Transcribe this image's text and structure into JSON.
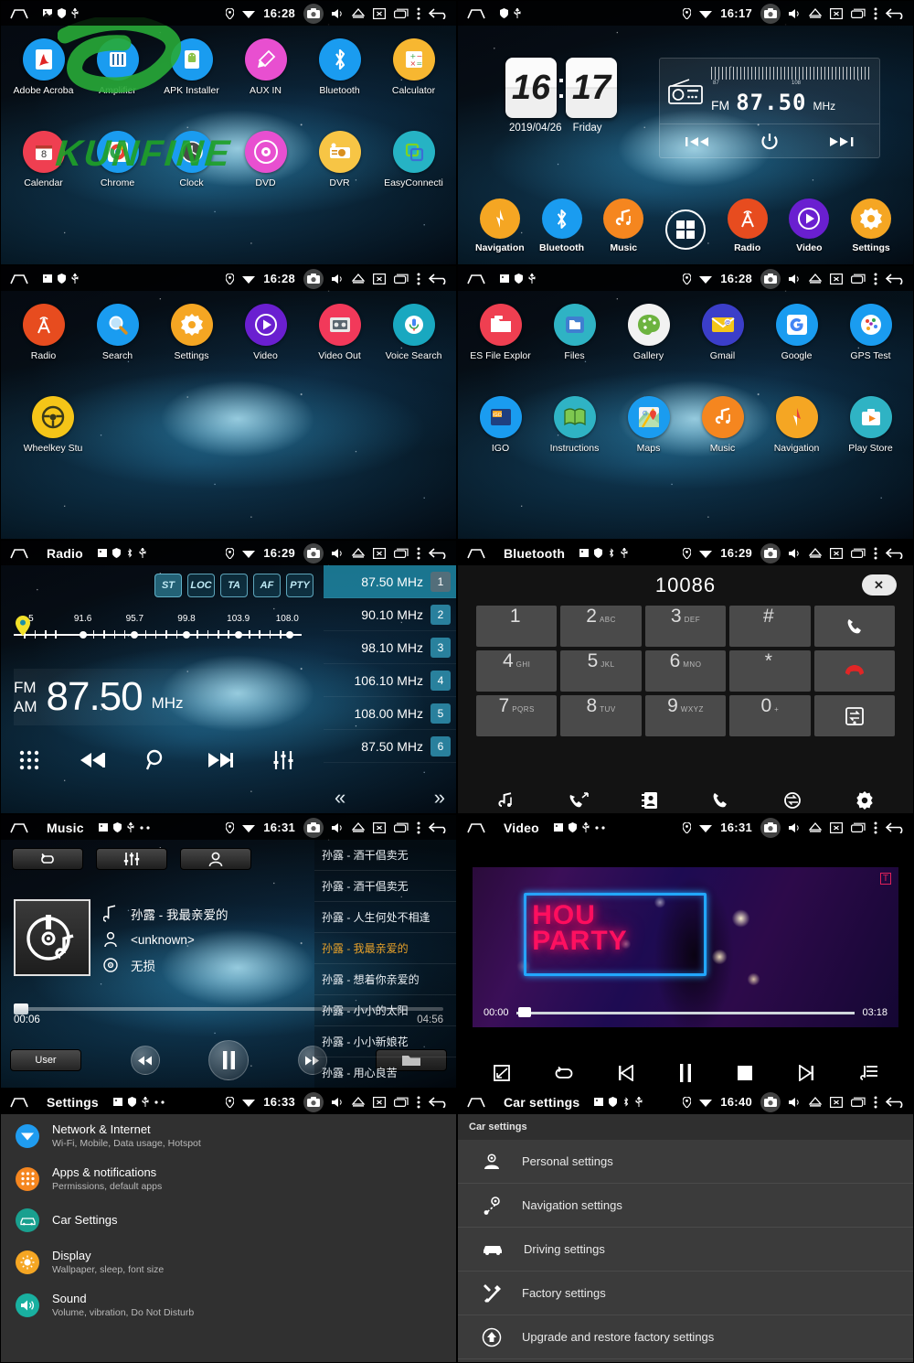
{
  "statusbar": {
    "icons_left": [
      "home-icon",
      "image-icon",
      "shield-icon",
      "usb-icon"
    ],
    "icons_right": [
      "location-icon",
      "wifi-icon",
      "camera-icon",
      "volume-icon",
      "eject-icon",
      "screen-off-icon",
      "recents-icon",
      "overflow-icon",
      "back-icon"
    ],
    "times": {
      "p1": "16:28",
      "p2": "16:17",
      "p3": "16:28",
      "p4": "16:28",
      "p5": "16:29",
      "p6": "16:29",
      "p7": "16:31",
      "p8": "16:31",
      "p9": "16:33",
      "p10": "16:40"
    },
    "titles": {
      "radio": "Radio",
      "bluetooth": "Bluetooth",
      "music": "Music",
      "video": "Video",
      "settings": "Settings",
      "car_settings": "Car settings"
    }
  },
  "watermark": "KUNFINE",
  "app_drawer_page1": {
    "row1": [
      {
        "label": "Adobe Acroba",
        "icon": "adobe-acrobat-icon",
        "color": "#1a9cf0"
      },
      {
        "label": "Amplifier",
        "icon": "amplifier-icon",
        "color": "#1a9cf0"
      },
      {
        "label": "APK Installer",
        "icon": "apk-installer-icon",
        "color": "#1a9cf0"
      },
      {
        "label": "AUX IN",
        "icon": "aux-in-icon",
        "color": "#e84fd0"
      },
      {
        "label": "Bluetooth",
        "icon": "bluetooth-icon",
        "color": "#1a9cf0"
      },
      {
        "label": "Calculator",
        "icon": "calculator-icon",
        "color": "#f7b731"
      }
    ],
    "row2": [
      {
        "label": "Calendar",
        "icon": "calendar-icon",
        "color": "#ef3f51",
        "badge": "8"
      },
      {
        "label": "Chrome",
        "icon": "chrome-icon",
        "color": "#1a9cf0"
      },
      {
        "label": "Clock",
        "icon": "clock-icon",
        "color": "#1a9cf0"
      },
      {
        "label": "DVD",
        "icon": "dvd-icon",
        "color": "#e84fd0"
      },
      {
        "label": "DVR",
        "icon": "dvr-icon",
        "color": "#f7c545"
      },
      {
        "label": "EasyConnecti",
        "icon": "easyconnection-icon",
        "color": "#26b3c4"
      }
    ]
  },
  "app_drawer_page2": {
    "row1": [
      {
        "label": "Radio",
        "icon": "radio-tower-icon",
        "color": "#e74c1f"
      },
      {
        "label": "Search",
        "icon": "search-icon",
        "color": "#1a9cf0"
      },
      {
        "label": "Settings",
        "icon": "gear-icon",
        "color": "#f5a623"
      },
      {
        "label": "Video",
        "icon": "video-play-icon",
        "color": "#6a1fd0"
      },
      {
        "label": "Video Out",
        "icon": "video-out-icon",
        "color": "#f2395a"
      },
      {
        "label": "Voice Search",
        "icon": "microphone-icon",
        "color": "#19a8c0"
      }
    ],
    "row2": [
      {
        "label": "Wheelkey Stu",
        "icon": "steering-wheel-icon",
        "color": "#f5c518"
      }
    ]
  },
  "app_drawer_page3": {
    "row1": [
      {
        "label": "ES File Explor",
        "icon": "es-file-explorer-icon",
        "color": "#ef3f51"
      },
      {
        "label": "Files",
        "icon": "files-icon",
        "color": "#2fb3c4"
      },
      {
        "label": "Gallery",
        "icon": "gallery-palette-icon",
        "color": "#f2f2f2"
      },
      {
        "label": "Gmail",
        "icon": "gmail-icon",
        "color": "#3b3ec9"
      },
      {
        "label": "Google",
        "icon": "google-icon",
        "color": "#1a9cf0"
      },
      {
        "label": "GPS Test",
        "icon": "gps-test-icon",
        "color": "#1a9cf0"
      }
    ],
    "row2": [
      {
        "label": "IGO",
        "icon": "igo-icon",
        "color": "#1a9cf0"
      },
      {
        "label": "Instructions",
        "icon": "instructions-book-icon",
        "color": "#2fb3c4"
      },
      {
        "label": "Maps",
        "icon": "maps-icon",
        "color": "#1a9cf0"
      },
      {
        "label": "Music",
        "icon": "music-note-icon",
        "color": "#f5861f"
      },
      {
        "label": "Navigation",
        "icon": "compass-icon",
        "color": "#f5a623"
      },
      {
        "label": "Play Store",
        "icon": "play-store-icon",
        "color": "#2fb3c4"
      }
    ]
  },
  "home": {
    "clock": {
      "hour": "16",
      "minute": "17",
      "date": "2019/04/26",
      "weekday": "Friday"
    },
    "radio_widget": {
      "band": "FM",
      "frequency": "87.50",
      "unit": "MHz",
      "scale_min": "87",
      "scale_max": "108",
      "prev_label": "prev-station-button",
      "power_label": "power-button",
      "next_label": "next-station-button"
    },
    "dock": [
      {
        "label": "Navigation",
        "icon": "compass-icon",
        "color": "#f5a623"
      },
      {
        "label": "Bluetooth",
        "icon": "bluetooth-icon",
        "color": "#1a9cf0"
      },
      {
        "label": "Music",
        "icon": "music-note-icon",
        "color": "#f5861f"
      },
      {
        "label": "",
        "icon": "all-apps-icon",
        "color": "transparent"
      },
      {
        "label": "Radio",
        "icon": "radio-tower-icon",
        "color": "#e74c1f"
      },
      {
        "label": "Video",
        "icon": "video-play-icon",
        "color": "#6a1fd0"
      },
      {
        "label": "Settings",
        "icon": "gear-icon",
        "color": "#f5a623"
      }
    ]
  },
  "radio": {
    "band_buttons": [
      {
        "label": "ST",
        "active": true
      },
      {
        "label": "LOC",
        "active": false
      },
      {
        "label": "TA",
        "active": false
      },
      {
        "label": "AF",
        "active": false
      },
      {
        "label": "PTY",
        "active": false
      }
    ],
    "scale_labels": [
      "5",
      "91.6",
      "95.7",
      "99.8",
      "103.9",
      "108.0"
    ],
    "band_fm": "FM",
    "band_am": "AM",
    "frequency": "87.50",
    "unit": "MHz",
    "presets": [
      {
        "freq": "87.50 MHz",
        "num": "1",
        "selected": true
      },
      {
        "freq": "90.10 MHz",
        "num": "2",
        "selected": false
      },
      {
        "freq": "98.10 MHz",
        "num": "3",
        "selected": false
      },
      {
        "freq": "106.10 MHz",
        "num": "4",
        "selected": false
      },
      {
        "freq": "108.00 MHz",
        "num": "5",
        "selected": false
      },
      {
        "freq": "87.50 MHz",
        "num": "6",
        "selected": false
      }
    ],
    "controls": [
      "apps-grid-icon",
      "prev-track-icon",
      "scan-search-icon",
      "next-track-icon",
      "equalizer-icon"
    ],
    "page_prev": "«",
    "page_next": "»"
  },
  "bluetooth": {
    "number": "10086",
    "delete_label": "✕",
    "keys": [
      {
        "d": "1",
        "s": ""
      },
      {
        "d": "2",
        "s": "ABC"
      },
      {
        "d": "3",
        "s": "DEF"
      },
      {
        "d": "#",
        "s": ""
      },
      {
        "d": "",
        "s": "",
        "icon": "call-icon"
      },
      {
        "d": "4",
        "s": "GHI"
      },
      {
        "d": "5",
        "s": "JKL"
      },
      {
        "d": "6",
        "s": "MNO"
      },
      {
        "d": "*",
        "s": ""
      },
      {
        "d": "",
        "s": "",
        "icon": "hangup-icon"
      },
      {
        "d": "7",
        "s": "PQRS"
      },
      {
        "d": "8",
        "s": "TUV"
      },
      {
        "d": "9",
        "s": "WXYZ"
      },
      {
        "d": "0",
        "s": "+"
      },
      {
        "d": "",
        "s": "",
        "icon": "transfer-icon"
      }
    ],
    "bottom_bar": [
      "bt-music-icon",
      "call-log-icon",
      "contacts-icon",
      "dialpad-call-icon",
      "sync-contacts-icon",
      "gear-icon"
    ]
  },
  "music": {
    "top_buttons": [
      "repeat-icon",
      "equalizer-icon",
      "artist-icon"
    ],
    "track_title": "孙露 - 我最亲爱的",
    "artist": "<unknown>",
    "quality": "无损",
    "time_current": "00:06",
    "time_total": "04:56",
    "user_button": "User",
    "controls": [
      "rewind-icon",
      "pause-icon",
      "forward-icon",
      "folder-icon"
    ],
    "playlist": [
      {
        "title": "孙露 - 酒干倡卖无",
        "current": false
      },
      {
        "title": "孙露 - 酒干倡卖无",
        "current": false
      },
      {
        "title": "孙露 - 人生何处不相逢",
        "current": false
      },
      {
        "title": "孙露 - 我最亲爱的",
        "current": true
      },
      {
        "title": "孙露 - 想着你亲爱的",
        "current": false
      },
      {
        "title": "孙露 - 小小的太阳",
        "current": false
      },
      {
        "title": "孙露 - 小小新娘花",
        "current": false
      },
      {
        "title": "孙露 - 用心良苦",
        "current": false
      }
    ]
  },
  "video": {
    "time_current": "00:00",
    "time_total": "03:18",
    "neon_line1": "HOU",
    "neon_line2": "PARTY",
    "controls": [
      "fullscreen-icon",
      "repeat-icon",
      "prev-icon",
      "pause-icon",
      "stop-icon",
      "next-icon",
      "playlist-icon"
    ]
  },
  "settings": {
    "items": [
      {
        "title": "Network & Internet",
        "sub": "Wi-Fi, Mobile, Data usage, Hotspot",
        "icon": "wifi-icon",
        "color": "#1f9cf0"
      },
      {
        "title": "Apps & notifications",
        "sub": "Permissions, default apps",
        "icon": "apps-grid-icon",
        "color": "#f5861f"
      },
      {
        "title": "Car Settings",
        "sub": "",
        "icon": "car-icon",
        "color": "#19a08f"
      },
      {
        "title": "Display",
        "sub": "Wallpaper, sleep, font size",
        "icon": "brightness-icon",
        "color": "#f5a623"
      },
      {
        "title": "Sound",
        "sub": "Volume, vibration, Do Not Disturb",
        "icon": "volume-icon",
        "color": "#19b0a0"
      }
    ]
  },
  "car_settings": {
    "header": "Car settings",
    "items": [
      {
        "title": "Personal settings",
        "icon": "person-gear-icon"
      },
      {
        "title": "Navigation settings",
        "icon": "route-pin-icon"
      },
      {
        "title": "Driving settings",
        "icon": "car-icon"
      },
      {
        "title": "Factory settings",
        "icon": "tools-icon"
      },
      {
        "title": "Upgrade and restore factory settings",
        "icon": "upgrade-icon"
      }
    ]
  }
}
